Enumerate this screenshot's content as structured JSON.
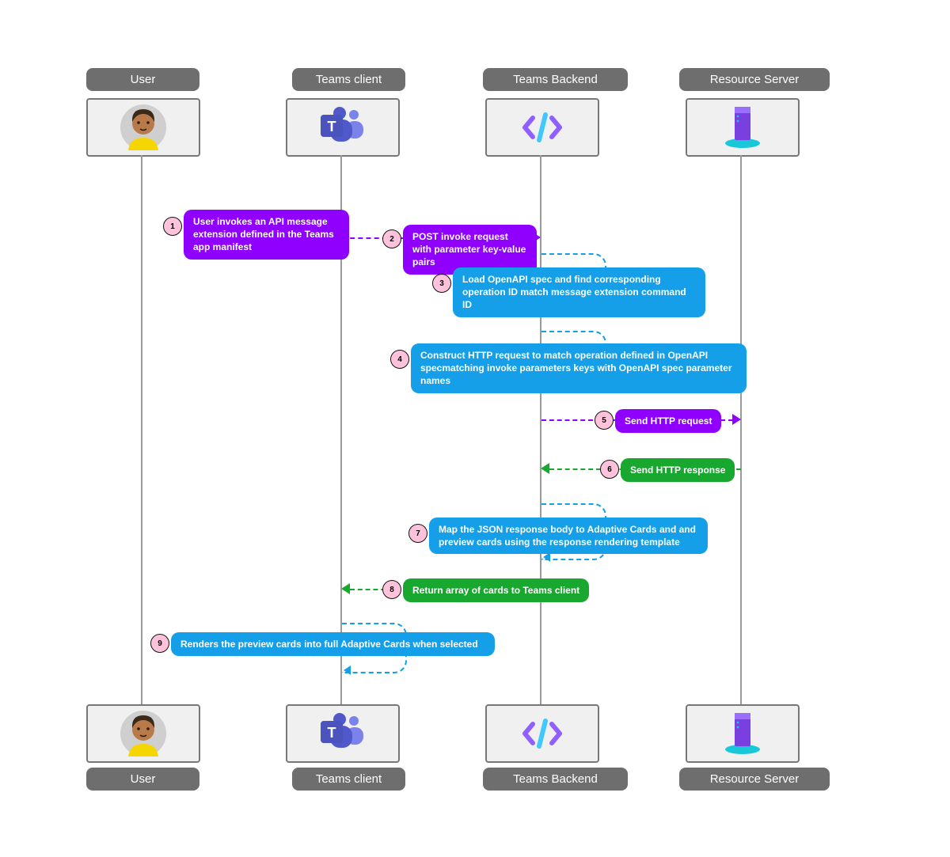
{
  "lanes": {
    "user": "User",
    "client": "Teams client",
    "backend": "Teams Backend",
    "server": "Resource Server"
  },
  "steps": {
    "s1": {
      "n": "1",
      "text": "User invokes an API message extension defined in the Teams app manifest"
    },
    "s2": {
      "n": "2",
      "text": "POST invoke request with parameter key-value pairs"
    },
    "s3": {
      "n": "3",
      "text": "Load OpenAPI spec and find corresponding operation ID match message extension command ID"
    },
    "s4": {
      "n": "4",
      "text": "Construct HTTP request to match operation defined in OpenAPI specmatching invoke parameters keys with OpenAPI spec parameter names"
    },
    "s5": {
      "n": "5",
      "text": "Send HTTP request"
    },
    "s6": {
      "n": "6",
      "text": "Send HTTP response"
    },
    "s7": {
      "n": "7",
      "text": "Map the JSON response body to  Adaptive Cards and  and preview cards using the response rendering template"
    },
    "s8": {
      "n": "8",
      "text": "Return array of cards to Teams client"
    },
    "s9": {
      "n": "9",
      "text": "Renders the preview cards into full Adaptive Cards when selected"
    }
  },
  "colors": {
    "purple": "#8f00ff",
    "blue": "#149fe8",
    "green": "#18a830",
    "pink": "#ffc2dc"
  },
  "chart_data": {
    "type": "sequence-diagram",
    "lanes": [
      "User",
      "Teams client",
      "Teams Backend",
      "Resource Server"
    ],
    "messages": [
      {
        "n": 1,
        "from": "User",
        "to": "Teams client",
        "kind": "self-note",
        "color": "purple",
        "text": "User invokes an API message extension defined in the Teams app manifest"
      },
      {
        "n": 2,
        "from": "Teams client",
        "to": "Teams Backend",
        "kind": "async",
        "color": "purple",
        "text": "POST invoke request with parameter key-value pairs"
      },
      {
        "n": 3,
        "from": "Teams Backend",
        "to": "Teams Backend",
        "kind": "self",
        "color": "blue",
        "text": "Load OpenAPI spec and find corresponding operation ID match message extension command ID"
      },
      {
        "n": 4,
        "from": "Teams Backend",
        "to": "Teams Backend",
        "kind": "self",
        "color": "blue",
        "text": "Construct HTTP request to match operation defined in OpenAPI specmatching invoke parameters keys with OpenAPI spec parameter names"
      },
      {
        "n": 5,
        "from": "Teams Backend",
        "to": "Resource Server",
        "kind": "async",
        "color": "purple",
        "text": "Send HTTP request"
      },
      {
        "n": 6,
        "from": "Resource Server",
        "to": "Teams Backend",
        "kind": "return",
        "color": "green",
        "text": "Send HTTP response"
      },
      {
        "n": 7,
        "from": "Teams Backend",
        "to": "Teams Backend",
        "kind": "self",
        "color": "blue",
        "text": "Map the JSON response body to  Adaptive Cards and  and preview cards using the response rendering template"
      },
      {
        "n": 8,
        "from": "Teams Backend",
        "to": "Teams client",
        "kind": "return",
        "color": "green",
        "text": "Return array of cards to Teams client"
      },
      {
        "n": 9,
        "from": "Teams client",
        "to": "Teams client",
        "kind": "self",
        "color": "blue",
        "text": "Renders the preview cards into full Adaptive Cards when selected"
      }
    ]
  }
}
